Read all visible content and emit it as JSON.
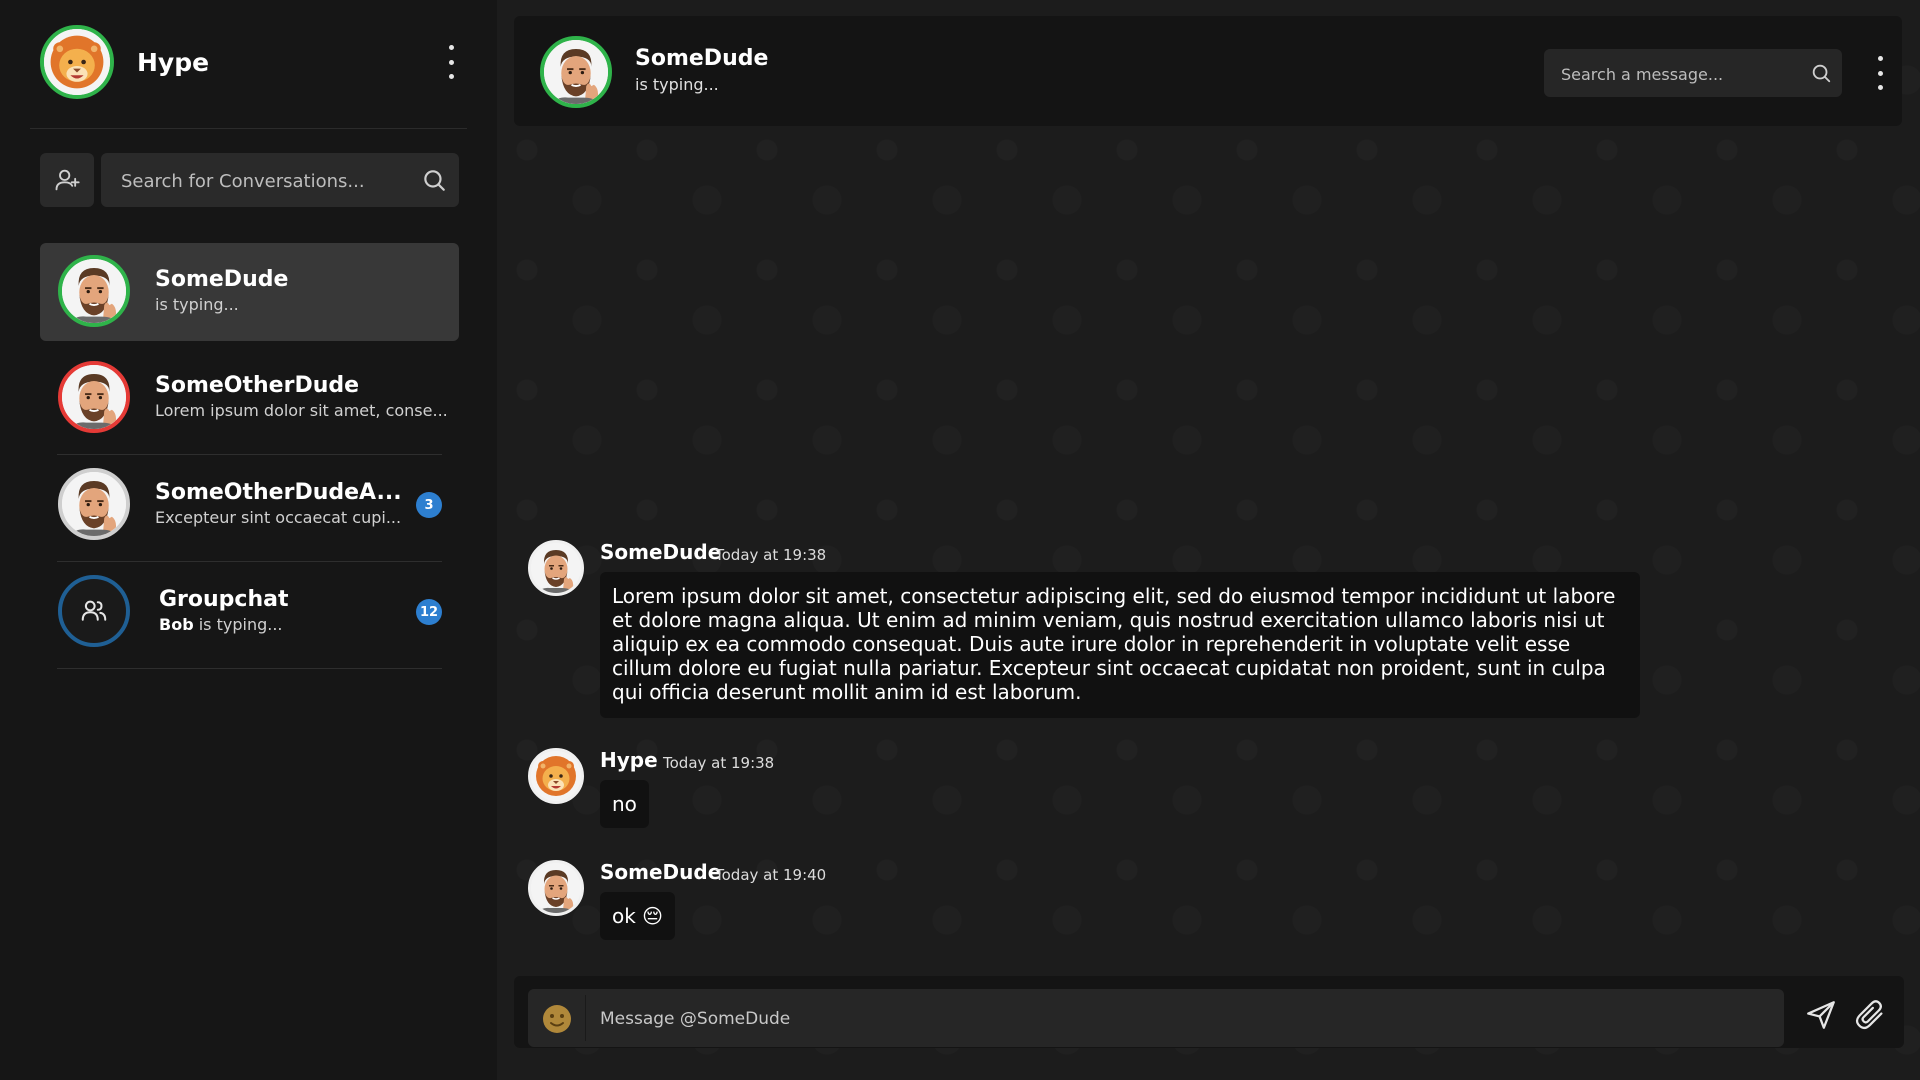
{
  "me": {
    "name": "Hype",
    "avatar": "lion-memoji"
  },
  "sidebar": {
    "add_contact_icon": "add-user-icon",
    "search": {
      "placeholder": "Search for Conversations..."
    },
    "conversations": [
      {
        "name": "SomeDude",
        "status": "is typing...",
        "ring": "#2fb34a",
        "active": true,
        "badge": ""
      },
      {
        "name": "SomeOtherDude",
        "status": "Lorem ipsum dolor sit amet, conse...",
        "ring": "#e53a36",
        "active": false,
        "badge": ""
      },
      {
        "name": "SomeOtherDudeA...",
        "status": "Excepteur sint occaecat cupi...",
        "ring": "#cfcfcf",
        "active": false,
        "badge": "3"
      },
      {
        "name": "Groupchat",
        "status_user": "Bob",
        "status": " is typing...",
        "ring": "#1f5f94",
        "active": false,
        "badge": "12"
      }
    ]
  },
  "chat": {
    "header": {
      "name": "SomeDude",
      "status": "is typing..."
    },
    "search": {
      "placeholder": "Search a message..."
    },
    "messages": [
      {
        "author": "SomeDude",
        "time": "Today at 19:38",
        "text": "Lorem ipsum dolor sit amet, consectetur adipiscing elit, sed do eiusmod tempor incididunt ut labore et dolore magna aliqua. Ut enim ad minim veniam, quis nostrud exercitation ullamco laboris nisi ut aliquip ex ea commodo consequat. Duis aute irure dolor in reprehenderit in voluptate velit esse cillum dolore eu fugiat nulla pariatur. Excepteur sint occaecat cupidatat non proident, sunt in culpa qui officia deserunt mollit anim id est laborum."
      },
      {
        "author": "Hype",
        "time": "Today at 19:38",
        "text": "no"
      },
      {
        "author": "SomeDude",
        "time": "Today at 19:40",
        "text": "ok 😔"
      }
    ],
    "composer": {
      "placeholder": "Message @SomeDude"
    }
  },
  "colors": {
    "online": "#2fb34a",
    "busy": "#e53a36",
    "offline": "#cfcfcf",
    "group": "#1f5f94",
    "badge": "#2d7fd0"
  }
}
